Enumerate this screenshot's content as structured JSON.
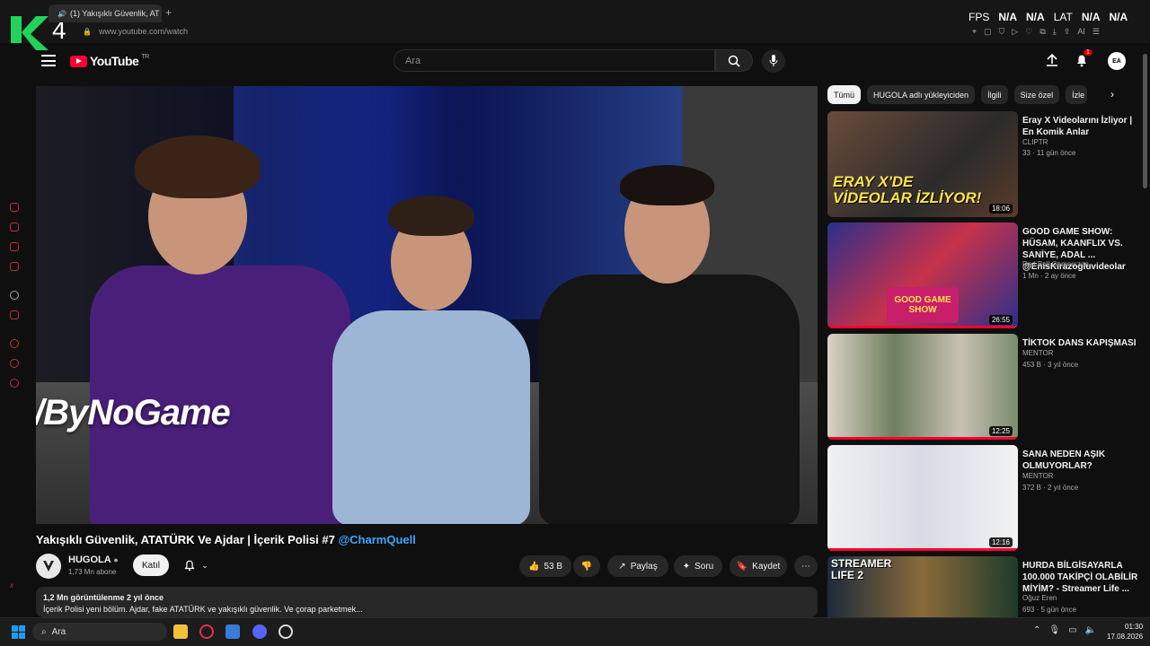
{
  "browser": {
    "tab_title": "(1) Yakışıklı Güvenlik, AT",
    "new_tab": "+",
    "url": "www.youtube.com/watch",
    "logo_text": "4",
    "overlay": [
      {
        "label": "FPS",
        "value": "N/A"
      },
      {
        "label": "",
        "value": "N/A"
      },
      {
        "label": "LAT",
        "value": "N/A"
      },
      {
        "label": "",
        "value": "N/A"
      }
    ],
    "ext_icons": [
      "pin-icon",
      "crop-icon",
      "shield-icon",
      "play-icon",
      "heart-icon",
      "puzzle-icon",
      "download-icon",
      "ai-icon",
      "menu-icon"
    ],
    "ai_label": "AI"
  },
  "header": {
    "logo_text": "YouTube",
    "logo_region": "TR",
    "search_placeholder": "Ara",
    "notif_count": "1",
    "avatar_initials": "EA"
  },
  "video": {
    "overlay_brand": "ByNoGame",
    "title_main": "Yakışıklı Güvenlik, ATATÜRK Ve Ajdar | İçerik Polisi #7",
    "title_mention": "@CharmQuell",
    "channel": "HUGOLA",
    "subscribers": "1,73 Mn abone",
    "join_label": "Katıl",
    "likes": "53 B",
    "share_label": "Paylaş",
    "ask_label": "Soru",
    "save_label": "Kaydet",
    "views": "1,2 Mn görüntülenme",
    "posted": "2 yıl önce",
    "description": "İçerik Polisi yeni bölüm. Ajdar, fake ATATÜRK ve yakışıklı güvenlik. Ve çorap parketmek..."
  },
  "chips": [
    "Tümü",
    "HUGOLA adlı yükleyiciden",
    "İlgili",
    "Size özel",
    "İzle"
  ],
  "recommendations": [
    {
      "title": "Eray X Videolarını İzliyor | En Komik Anlar",
      "channel": "CLIPTR",
      "meta": "33 · 11 gün önce",
      "duration": "18:06",
      "thumb_text": "ERAY X'DE VİDEOLAR İZLİYOR!",
      "progress": 0
    },
    {
      "title": "GOOD GAME SHOW: HÜSAM, KAANFLIX VS. SANİYE, ADAL ... @EnisKirazogluvideolar",
      "channel": "Red Bull Gamerszon",
      "meta": "1 Mn · 2 ay önce",
      "duration": "26:55",
      "thumb_text": "GOOD GAME SHOW",
      "progress": 1
    },
    {
      "title": "TİKTOK DANS KAPIŞMASI",
      "channel": "MENTOR",
      "meta": "453 B · 3 yıl önce",
      "duration": "12:25",
      "thumb_text": "",
      "progress": 1
    },
    {
      "title": "SANA NEDEN AŞIK OLMUYORLAR?",
      "channel": "MENTOR",
      "meta": "372 B · 2 yıl önce",
      "duration": "12:16",
      "thumb_text": "",
      "progress": 1
    },
    {
      "title": "HURDA BİLGİSAYARLA 100.000 TAKİPÇİ OLABİLİR MİYİM? - Streamer Life ...",
      "channel": "Oğuz Eren",
      "meta": "693 · 5 gün önce",
      "duration": "",
      "thumb_text": "STREAMER LIFE 2",
      "progress": 0
    }
  ],
  "taskbar": {
    "search_placeholder": "Ara",
    "time": "01:30",
    "date": "17.08.2026"
  }
}
